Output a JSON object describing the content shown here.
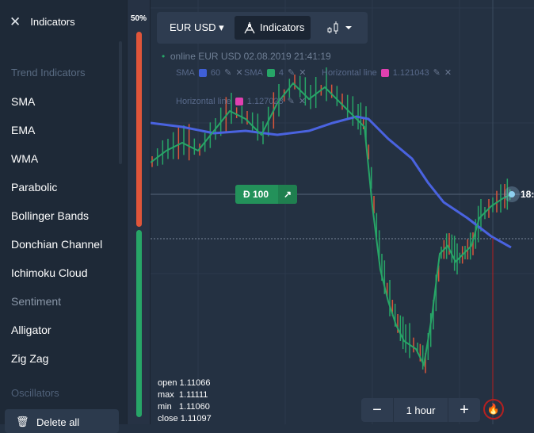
{
  "sidebar": {
    "title": "Indicators",
    "items": [
      {
        "label": "Trend Indicators",
        "type": "cat"
      },
      {
        "label": "SMA"
      },
      {
        "label": "EMA"
      },
      {
        "label": "WMA"
      },
      {
        "label": "Parabolic"
      },
      {
        "label": "Bollinger Bands"
      },
      {
        "label": "Donchian Channel"
      },
      {
        "label": "Ichimoku Cloud"
      },
      {
        "label": "Sentiment",
        "type": "mid"
      },
      {
        "label": "Alligator"
      },
      {
        "label": "Zig Zag"
      }
    ],
    "oscillators": "Oscillators",
    "delete_all": "Delete all"
  },
  "meter": {
    "percent": "50%",
    "value": 50,
    "colors": {
      "down": "#e0553a",
      "up": "#27a567"
    }
  },
  "toolbar": {
    "pair": "EUR USD",
    "indicators": "Indicators"
  },
  "info": {
    "status": "online",
    "pair": "EUR USD",
    "datetime": "02.08.2019 21:41:19"
  },
  "legend": [
    {
      "name": "SMA",
      "color": "#3f5fd6",
      "value": "60"
    },
    {
      "name": "SMA",
      "color": "#27a567",
      "value": "4"
    },
    {
      "name": "Horizontal line",
      "color": "#e040b0",
      "value": "1.121043"
    },
    {
      "name": "Horizontal line",
      "color": "#e040b0",
      "value": "1.127028"
    }
  ],
  "deal": {
    "amount": "Ð 100"
  },
  "price_label": "18:",
  "ohlc": {
    "open": "open 1.11066",
    "max": "max  1.11111",
    "min": "min   1.11060",
    "close": "close 1.11097"
  },
  "timeframe": {
    "value": "1 hour",
    "minus": "−",
    "plus": "+"
  }
}
